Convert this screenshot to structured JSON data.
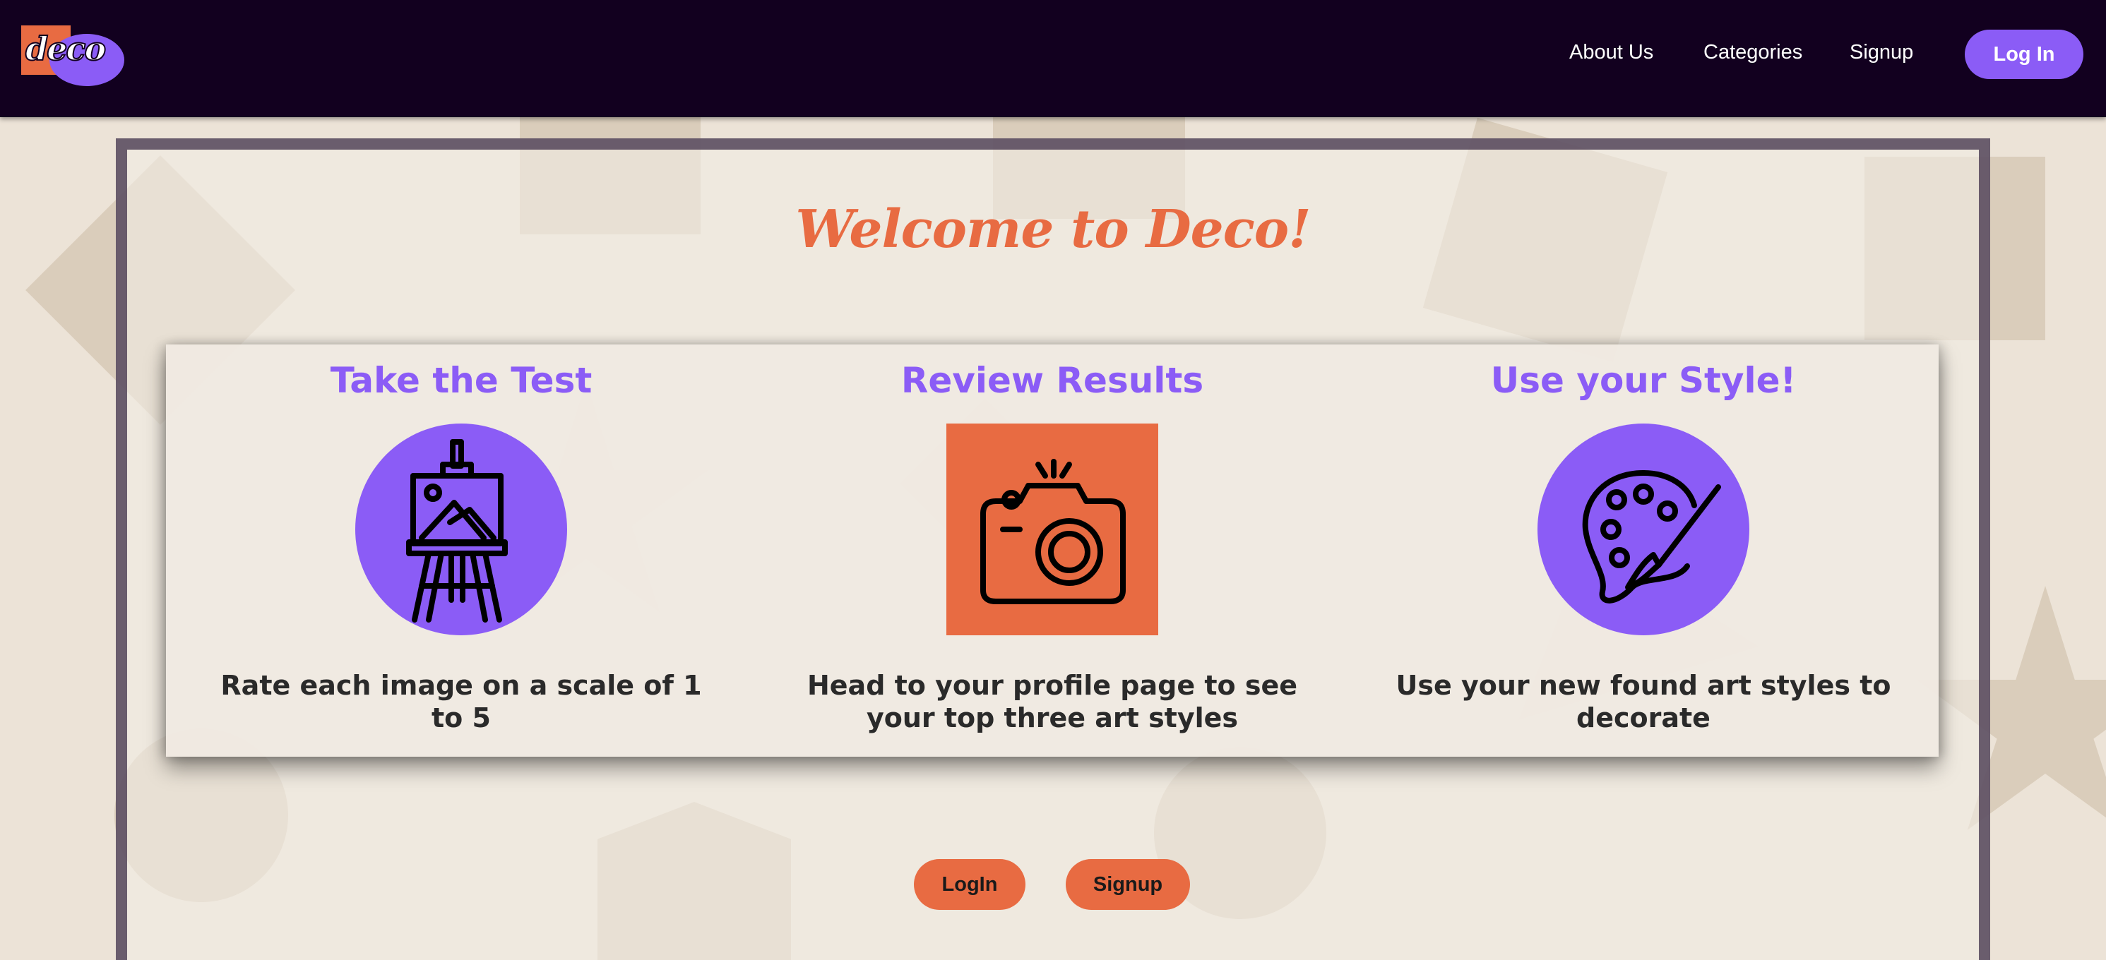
{
  "nav": {
    "logo_text": "deco",
    "links": [
      "About Us",
      "Categories",
      "Signup"
    ],
    "login_label": "Log In"
  },
  "main": {
    "welcome": "Welcome to Deco!",
    "steps": [
      {
        "title": "Take the Test",
        "icon": "easel-icon",
        "description": "Rate each image on a scale of 1 to 5"
      },
      {
        "title": "Review Results",
        "icon": "camera-icon",
        "description": "Head to your profile page to see your top three art styles"
      },
      {
        "title": "Use your Style!",
        "icon": "palette-icon",
        "description": "Use your new found art styles to decorate"
      }
    ],
    "buttons": {
      "login": "LogIn",
      "signup": "Signup"
    }
  },
  "colors": {
    "navbar": "#12001f",
    "accent_purple": "#8b5cf6",
    "accent_orange": "#e86b42",
    "background": "#ece3d7"
  }
}
